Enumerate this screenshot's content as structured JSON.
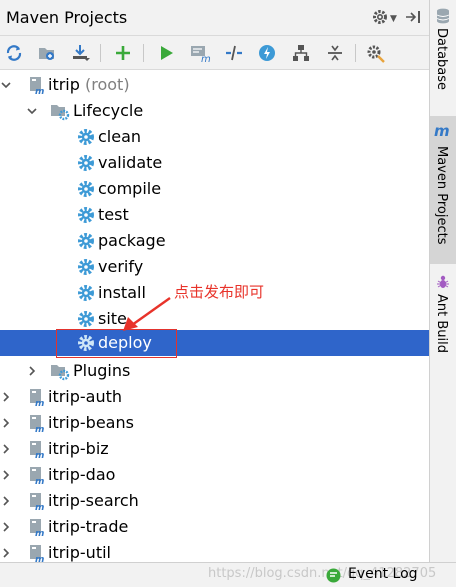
{
  "panel": {
    "title": "Maven Projects"
  },
  "toolbar": {
    "buttons": [
      "reimport-icon",
      "generate-sources-icon",
      "download-sources-icon",
      "add-maven-project-icon",
      "run-maven-build-icon",
      "execute-maven-goal-icon",
      "toggle-offline-mode-icon",
      "skip-tests-icon",
      "show-dependencies-icon",
      "collapse-all-icon",
      "maven-settings-icon"
    ]
  },
  "tree": {
    "root_label": "itrip",
    "root_suffix": "(root)",
    "lifecycle": "Lifecycle",
    "goals": [
      "clean",
      "validate",
      "compile",
      "test",
      "package",
      "verify",
      "install",
      "site",
      "deploy"
    ],
    "plugins": "Plugins",
    "modules": [
      "itrip-auth",
      "itrip-beans",
      "itrip-biz",
      "itrip-dao",
      "itrip-search",
      "itrip-trade",
      "itrip-util"
    ]
  },
  "annotation": {
    "text": "点击发布即可",
    "color": "#e8332a"
  },
  "side_tabs": {
    "database": "Database",
    "maven": "Maven Projects",
    "ant": "Ant Build"
  },
  "status": {
    "event_log": "Event Log",
    "watermark": "https://blog.csdn.net/qq_41282705"
  },
  "colors": {
    "selection": "#2f65ca",
    "goal_gear": "#3d9ad6",
    "run_green": "#3aa93a"
  }
}
